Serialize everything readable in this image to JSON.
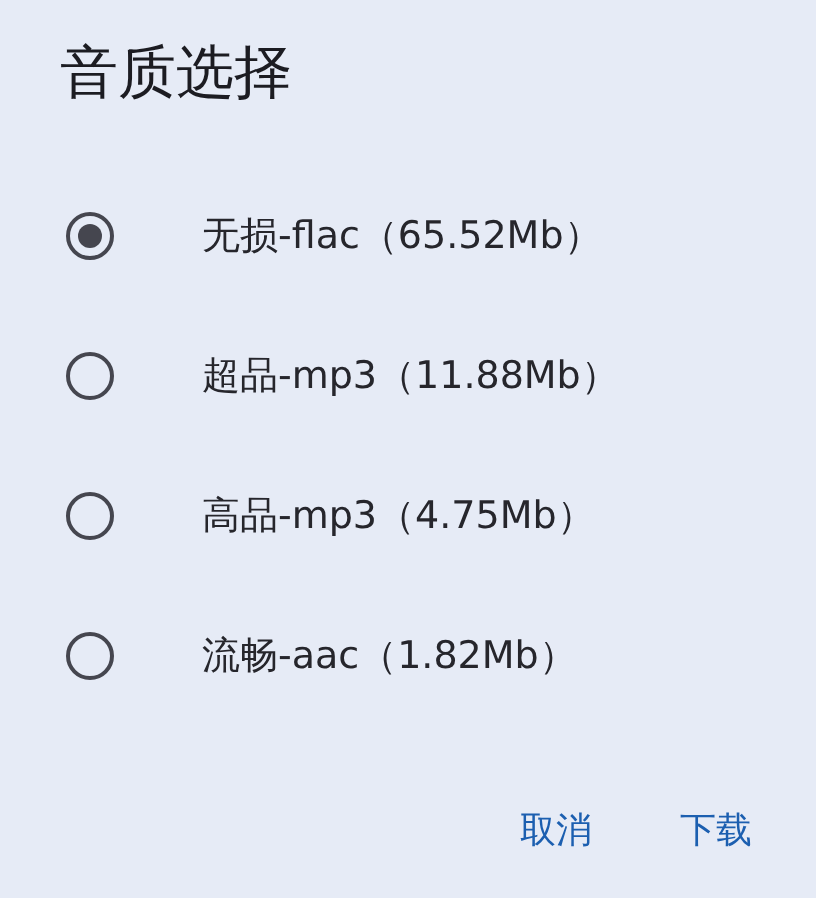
{
  "dialog": {
    "title": "音质选择",
    "options": [
      {
        "label": "无损-flac（65.52Mb）",
        "selected": true
      },
      {
        "label": "超品-mp3（11.88Mb）",
        "selected": false
      },
      {
        "label": "高品-mp3（4.75Mb）",
        "selected": false
      },
      {
        "label": "流畅-aac（1.82Mb）",
        "selected": false
      }
    ],
    "buttons": [
      "取消",
      "下载"
    ]
  }
}
